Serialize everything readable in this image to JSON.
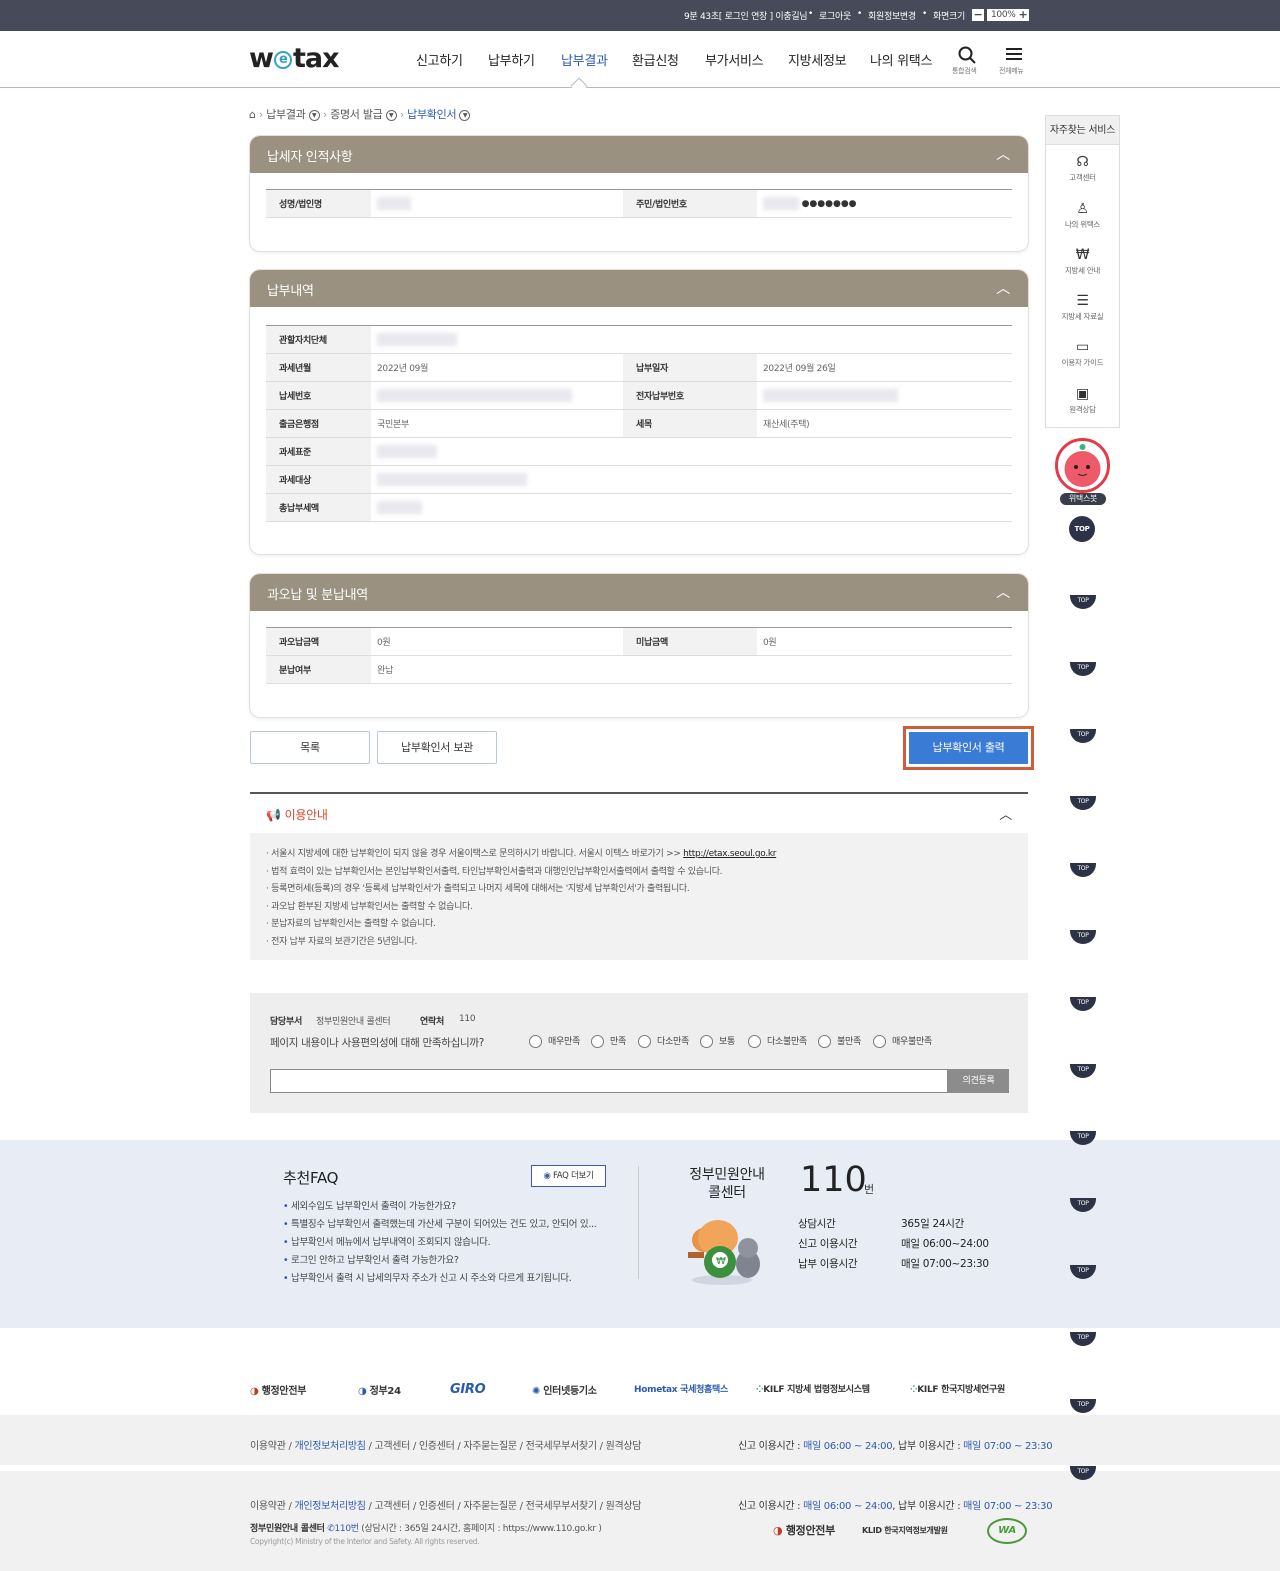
{
  "topbar": {
    "session": "9분 43초[ 로그인 연장 ] 이충길님",
    "logout": "로그아웃",
    "edit_info": "회원정보변경",
    "screen_size": "화면크기",
    "zoom": "100%"
  },
  "header": {
    "logo": "wetax",
    "nav": [
      "신고하기",
      "납부하기",
      "납부결과",
      "환급신청",
      "부가서비스",
      "지방세정보",
      "나의 위택스"
    ],
    "search_label": "통합검색",
    "menu_label": "전체메뉴"
  },
  "breadcrumb": [
    "납부결과",
    "증명서 발급",
    "납부확인서"
  ],
  "payer": {
    "title": "납세자 인적사항",
    "name_label": "성명/법인명",
    "id_label": "주민/법인번호",
    "id_value": "●●●●●●●"
  },
  "payment": {
    "title": "납부내역",
    "rows": {
      "authority": "관할자치단체",
      "period": "과세년월",
      "period_value": "2022년 09월",
      "pay_date": "납부일자",
      "pay_date_value": "2022년 09월 26일",
      "tax_no": "납세번호",
      "e_no": "전자납부번호",
      "bank": "출금은행점",
      "bank_value": "국민본부",
      "item": "세목",
      "item_value": "재산세(주택)",
      "base": "과세표준",
      "object": "과세대상",
      "total": "총납부세액"
    }
  },
  "overpay": {
    "title": "과오납 및 분납내역",
    "over_label": "과오납금액",
    "over_value": "0원",
    "unpaid_label": "미납금액",
    "unpaid_value": "0원",
    "split_label": "분납여부",
    "split_value": "완납"
  },
  "buttons": {
    "list": "목록",
    "store": "납부확인서 보관",
    "print": "납부확인서 출력"
  },
  "notice": {
    "title": "이용안내",
    "items": [
      "서울시 지방세에 대한 납부확인이 되지 않을 경우 서울이택스로 문의하시기 바랍니다. 서울시 이택스 바로가기 >>",
      "법적 효력이 있는 납부확인서는 본인납부확인서출력, 타인납부확인서출력과 대행인인납부확인서출력에서 출력할 수 있습니다.",
      "등록면허세(등록)의 경우 '등록세 납부확인서'가 출력되고 나머지 세목에 대해서는 '지방세 납부확인서'가 출력됩니다.",
      "과오납 환부된 지방세 납부확인서는 출력할 수 없습니다.",
      "분납자료의 납부확인서는 출력할 수 없습니다.",
      "전자 납부 자료의 보관기간은 5년입니다."
    ],
    "link": "http://etax.seoul.go.kr"
  },
  "survey": {
    "dept_label": "담당부서",
    "dept": "정부민원안내 콜센터",
    "contact_label": "연락처",
    "contact": "110",
    "question": "페이지 내용이나 사용편의성에 대해 만족하십니까?",
    "options": [
      "매우만족",
      "만족",
      "다소만족",
      "보통",
      "다소불만족",
      "불만족",
      "매우불만족"
    ],
    "submit": "의견등록"
  },
  "faq": {
    "title": "추천FAQ",
    "more": "FAQ 더보기",
    "items": [
      "세외수입도 납부확인서 출력이 가능한가요?",
      "특별징수 납부확인서 출력했는데 가산세 구분이 되어있는 건도 있고, 안되어 있...",
      "납부확인서 메뉴에서 납부내역이 조회되지 않습니다.",
      "로그인 안하고 납부확인서 출력 가능한가요?",
      "납부확인서 출력 시 납세의무자 주소가 신고 시 주소와 다르게 표기됩니다."
    ],
    "call_title_1": "정부민원안내",
    "call_title_2": "콜센터",
    "call_no": "110",
    "call_unit": "번",
    "hours": [
      {
        "label": "상담시간",
        "value": "365일 24시간"
      },
      {
        "label": "신고 이용시간",
        "value": "매일 06:00~24:00"
      },
      {
        "label": "납부 이용시간",
        "value": "매일 07:00~23:30"
      }
    ]
  },
  "logos": [
    "행정안전부",
    "정부24",
    "GIRO",
    "인터넷등기소",
    "Hometax 국세청홈택스",
    "KILF 지방세 법령정보시스템",
    "KILF 한국지방세연구원"
  ],
  "footer": {
    "links": [
      "이용약관",
      "개인정보처리방침",
      "고객센터",
      "인증센터",
      "자주묻는질문",
      "전국세무부서찾기",
      "원격상담"
    ],
    "hours_prefix1": "신고 이용시간 :",
    "hours_value1": "매일 06:00 ~ 24:00",
    "hours_prefix2": ", 납부 이용시간 :",
    "hours_value2": "매일 07:00 ~ 23:30",
    "call_center": "정부민원안내 콜센터",
    "call_no": "110번",
    "call_info": "(상담시간 : 365일 24시간, 홈페이지 : https://www.110.go.kr )",
    "copyright": "Copyright(c) Ministry of the Interior and Safety. All rights reserved.",
    "org1": "행정안전부",
    "org2": "KLID 한국지역정보개발원",
    "org3": "WA"
  },
  "quick": {
    "title": "자주찾는 서비스",
    "items": [
      "고객센터",
      "나의 위택스",
      "지방세 안내",
      "지방세 자료실",
      "이용자 가이드",
      "원격상담"
    ],
    "bot": "위택스봇",
    "top": "TOP"
  },
  "colors": {
    "accent": "#2a5bb0",
    "panel_head": "#9b9180",
    "print_button": "#3a7bd5",
    "highlight": "#d25b3c",
    "topbar": "#474a58"
  }
}
